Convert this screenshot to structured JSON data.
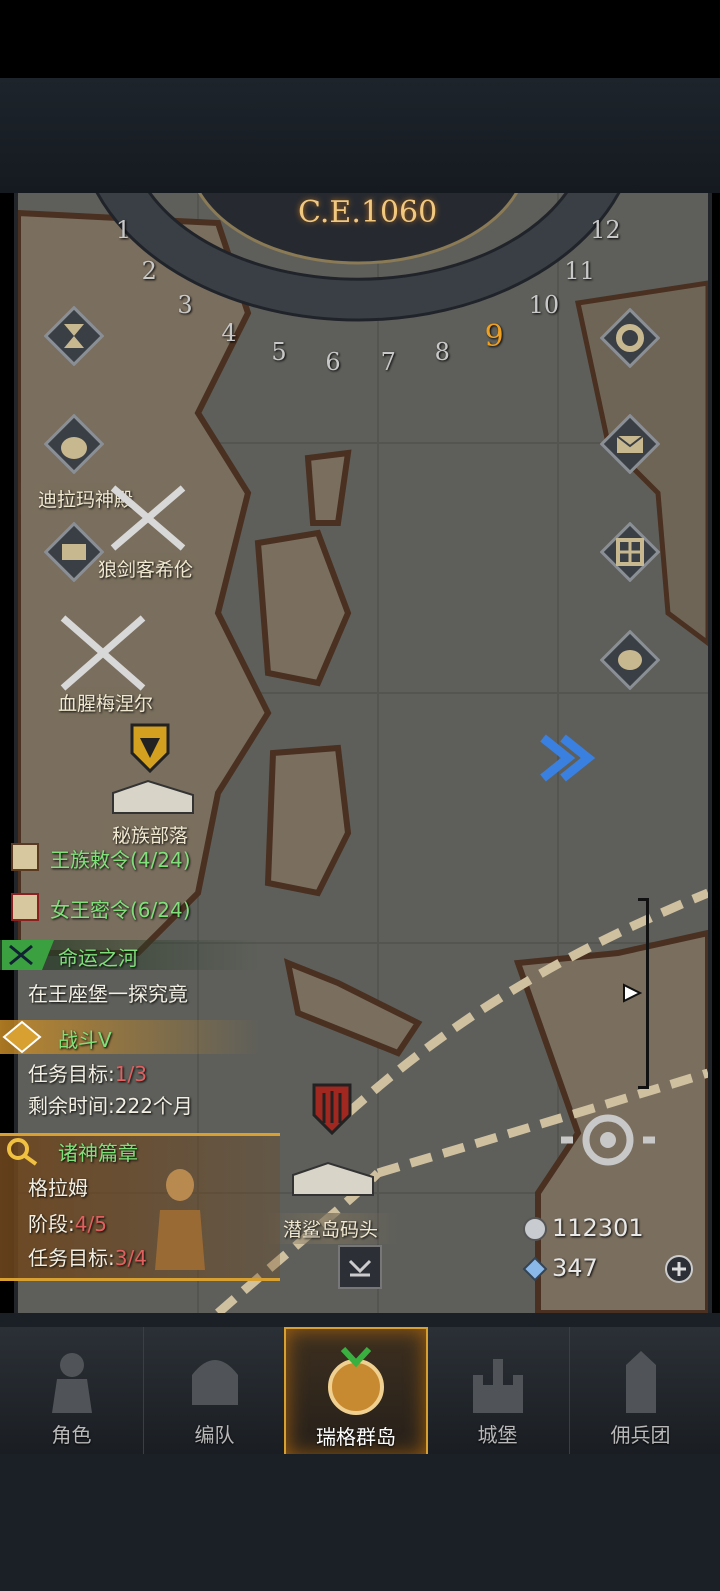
{
  "calendar": {
    "era": "C.E.1060",
    "months": [
      "1",
      "2",
      "3",
      "4",
      "5",
      "6",
      "7",
      "8",
      "9",
      "10",
      "11",
      "12"
    ],
    "current_month": "9"
  },
  "map_labels": {
    "place1": "迪拉玛神殿",
    "place2": "狼剑客希伦",
    "place3": "血腥梅涅尔",
    "place4": "秘族部落",
    "place5": "潜鲨岛码头"
  },
  "quests": {
    "royal_decree": {
      "title": "王族敕令",
      "progress": "(4/24)"
    },
    "queen_secret": {
      "title": "女王密令",
      "progress": "(6/24)"
    },
    "river": {
      "title": "命运之河",
      "desc": "在王座堡一探究竟"
    },
    "battle": {
      "title": "战斗V",
      "goal_label": "任务目标:",
      "goal_value": "1/3",
      "time_label": "剩余时间:",
      "time_value": "222个月"
    },
    "gods": {
      "title": "诸神篇章",
      "hero": "格拉姆",
      "stage_label": "阶段:",
      "stage_value": "4/5",
      "goal_label": "任务目标:",
      "goal_value": "3/4"
    }
  },
  "resources": {
    "silver": "112301",
    "crystal": "347"
  },
  "nav": {
    "tabs": [
      {
        "label": "角色"
      },
      {
        "label": "编队"
      },
      {
        "label": "瑞格群岛"
      },
      {
        "label": "城堡"
      },
      {
        "label": "佣兵团"
      }
    ],
    "active_index": 2
  },
  "colors": {
    "accent": "#d8a030",
    "quest_green": "#7fe07a",
    "highlight_red": "#e06060"
  }
}
